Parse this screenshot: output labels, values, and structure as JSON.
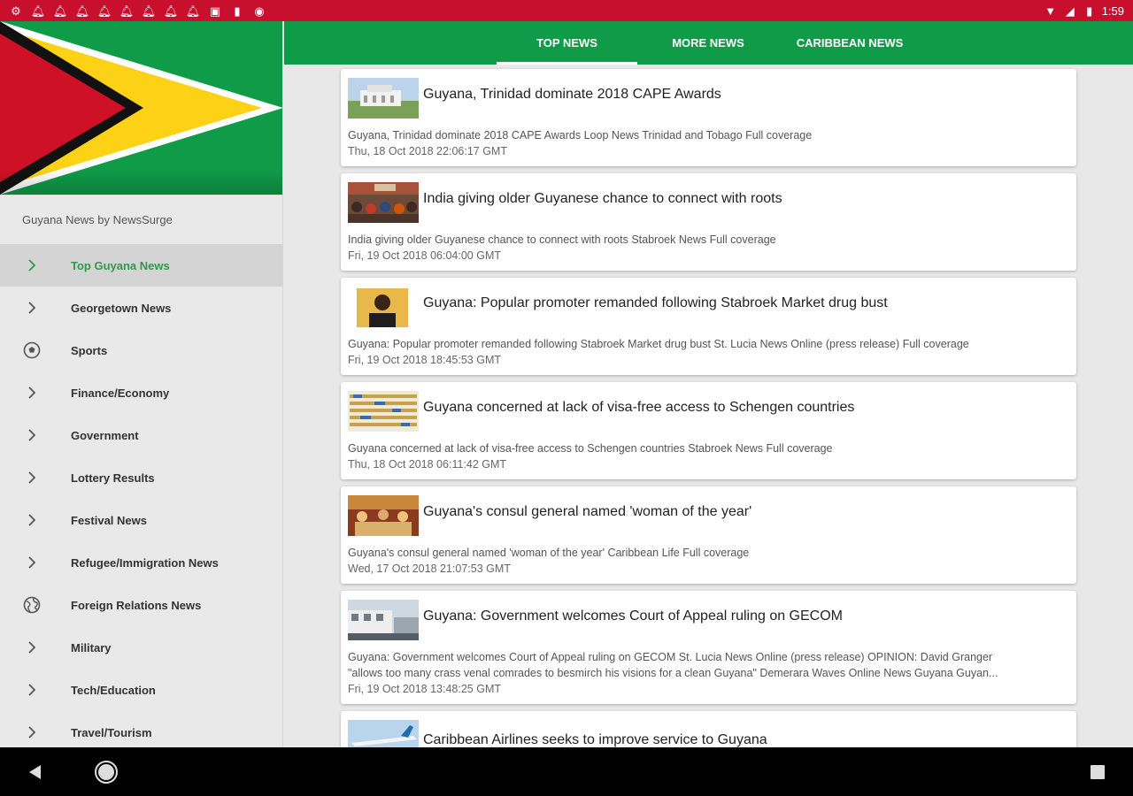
{
  "status_bar": {
    "time": "1:59",
    "left_icons": [
      "settings-icon",
      "bell-icon",
      "bell-icon",
      "bell-icon",
      "bell-icon",
      "bell-icon",
      "bell-icon",
      "bell-icon",
      "bell-icon",
      "image-icon",
      "sd-card-icon",
      "record-icon"
    ],
    "right_icons": [
      "wifi-icon",
      "signal-icon",
      "battery-icon"
    ]
  },
  "drawer": {
    "header": "Guyana News by NewsSurge",
    "items": [
      {
        "label": "Top Guyana News",
        "icon": "chevron-right-icon",
        "active": true
      },
      {
        "label": "Georgetown News",
        "icon": "chevron-right-icon"
      },
      {
        "label": "Sports",
        "icon": "soccer-ball-icon"
      },
      {
        "label": "Finance/Economy",
        "icon": "chevron-right-icon"
      },
      {
        "label": "Government",
        "icon": "chevron-right-icon"
      },
      {
        "label": "Lottery Results",
        "icon": "chevron-right-icon"
      },
      {
        "label": "Festival News",
        "icon": "chevron-right-icon"
      },
      {
        "label": "Refugee/Immigration News",
        "icon": "chevron-right-icon"
      },
      {
        "label": "Foreign Relations News",
        "icon": "globe-icon"
      },
      {
        "label": "Military",
        "icon": "chevron-right-icon"
      },
      {
        "label": "Tech/Education",
        "icon": "chevron-right-icon"
      },
      {
        "label": "Travel/Tourism",
        "icon": "chevron-right-icon"
      }
    ]
  },
  "tabs": [
    {
      "label": "TOP NEWS",
      "active": true
    },
    {
      "label": "MORE NEWS"
    },
    {
      "label": "CARIBBEAN NEWS"
    }
  ],
  "articles": [
    {
      "title": "Guyana, Trinidad dominate 2018 CAPE Awards",
      "summary": "Guyana, Trinidad dominate 2018 CAPE Awards  Loop News Trinidad and Tobago  Full coverage",
      "date": "Thu, 18 Oct 2018 22:06:17 GMT"
    },
    {
      "title": "India giving older Guyanese chance to connect with roots",
      "summary": "India giving older Guyanese chance to connect with roots  Stabroek News  Full coverage",
      "date": "Fri, 19 Oct 2018 06:04:00 GMT"
    },
    {
      "title": "Guyana: Popular promoter remanded following Stabroek Market drug bust",
      "summary": "Guyana: Popular promoter remanded following Stabroek Market drug bust  St. Lucia News Online (press release)  Full coverage",
      "date": "Fri, 19 Oct 2018 18:45:53 GMT"
    },
    {
      "title": "Guyana concerned at lack of visa-free access to Schengen countries",
      "summary": "Guyana concerned at lack of visa-free access to Schengen countries  Stabroek News  Full coverage",
      "date": "Thu, 18 Oct 2018 06:11:42 GMT"
    },
    {
      "title": "Guyana's consul general named 'woman of the year'",
      "summary": "Guyana's consul general named 'woman of the year'  Caribbean Life  Full coverage",
      "date": "Wed, 17 Oct 2018 21:07:53 GMT"
    },
    {
      "title": "Guyana: Government welcomes Court of Appeal ruling on GECOM",
      "summary": "Guyana: Government welcomes Court of Appeal ruling on GECOM  St. Lucia News Online (press release)  OPINION: David Granger",
      "summary2": "\"allows too many crass venal comrades to besmirch his visions for a clean Guyana\"  Demerara Waves Online News Guyana  Guyan...",
      "date": "Fri, 19 Oct 2018 13:48:25 GMT"
    },
    {
      "title": "Caribbean Airlines seeks to improve service to Guyana"
    }
  ],
  "nav_bar": {
    "buttons": [
      "back-icon",
      "home-icon",
      "recents-icon"
    ]
  },
  "colors": {
    "status_red": "#c8102e",
    "toolbar_green": "#109b48",
    "active_green": "#2e9a4a",
    "flag_yellow": "#fcd116",
    "flag_red": "#ce1126"
  }
}
